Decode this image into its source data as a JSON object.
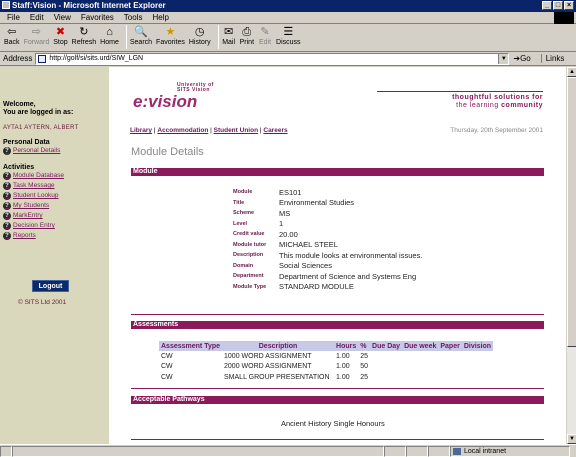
{
  "window": {
    "title": "Staff:Vision - Microsoft Internet Explorer",
    "btn_min": "_",
    "btn_max": "□",
    "btn_close": "×"
  },
  "menu": [
    "File",
    "Edit",
    "View",
    "Favorites",
    "Tools",
    "Help"
  ],
  "toolbar": {
    "back": "Back",
    "forward": "Forward",
    "stop": "Stop",
    "refresh": "Refresh",
    "home": "Home",
    "search": "Search",
    "favorites": "Favorites",
    "history": "History",
    "mail": "Mail",
    "print": "Print",
    "edit": "Edit",
    "discuss": "Discuss"
  },
  "address": {
    "label": "Address",
    "url": "http://golf/si/sits.urd/SIW_LGN",
    "go": "Go",
    "links": "Links"
  },
  "sidebar": {
    "welcome": "Welcome,",
    "logged_in": "You are logged in as:",
    "username": "AYTA1 AYTERN, ALBERT",
    "personal_heading": "Personal Data",
    "personal_links": [
      "Personal Details"
    ],
    "activities_heading": "Activities",
    "activity_links": [
      "Module Database",
      "Task Message",
      "Student Lookup",
      "My Students",
      "MarkEntry",
      "Decision Entry",
      "Reports"
    ],
    "logout": "Logout",
    "copyright": "© SITS Ltd 2001"
  },
  "header": {
    "logo_top": "University of\nSITS Vision",
    "logo_main": "e:vision",
    "tagline_1": "thoughtful solutions for",
    "tagline_2_plain": "the learning ",
    "tagline_2_bold": "community",
    "nav": [
      "Library",
      "Accommodation",
      "Student Union",
      "Careers"
    ],
    "nav_sep": "|",
    "date": "Thursday, 20th September 2001"
  },
  "page_title": "Module Details",
  "module_section": "Module",
  "module": [
    {
      "label": "Module",
      "value": "ES101"
    },
    {
      "label": "Title",
      "value": "Environmental Studies"
    },
    {
      "label": "Scheme",
      "value": "MS"
    },
    {
      "label": "Level",
      "value": "1"
    },
    {
      "label": "Credit value",
      "value": "20.00"
    },
    {
      "label": "Module tutor",
      "value": "MICHAEL STEEL"
    },
    {
      "label": "Description",
      "value": "This module looks at environmental issues."
    },
    {
      "label": "Domain",
      "value": "Social Sciences"
    },
    {
      "label": "Department",
      "value": "Department of Science and Systems Eng"
    },
    {
      "label": "Module Type",
      "value": "STANDARD MODULE"
    }
  ],
  "assessments_section": "Assessments",
  "assessments": {
    "columns": [
      "Assessment Type",
      "Description",
      "Hours",
      "%",
      "Due Day",
      "Due week",
      "Paper",
      "Division"
    ],
    "rows": [
      [
        "CW",
        "1000 WORD ASSIGNMENT",
        "1.00",
        "25",
        "",
        "",
        "",
        ""
      ],
      [
        "CW",
        "2000 WORD ASSIGNMENT",
        "1.00",
        "50",
        "",
        "",
        "",
        ""
      ],
      [
        "CW",
        "SMALL GROUP PRESENTATION",
        "1.00",
        "25",
        "",
        "",
        "",
        ""
      ]
    ]
  },
  "pathways_section": "Acceptable Pathways",
  "pathways": [
    "Ancient History Single Honours"
  ],
  "status": {
    "zone": "Local intranet"
  }
}
